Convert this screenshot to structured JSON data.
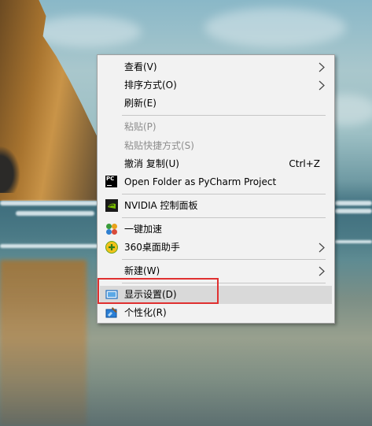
{
  "context_menu": {
    "items": [
      {
        "label": "查看(V)"
      },
      {
        "label": "排序方式(O)"
      },
      {
        "label": "刷新(E)"
      },
      {
        "label": "粘贴(P)"
      },
      {
        "label": "粘贴快捷方式(S)"
      },
      {
        "label": "撤消 复制(U)",
        "shortcut": "Ctrl+Z"
      },
      {
        "label": "Open Folder as PyCharm Project",
        "icon_text": "PC"
      },
      {
        "label": "NVIDIA 控制面板"
      },
      {
        "label": "一键加速"
      },
      {
        "label": "360桌面助手"
      },
      {
        "label": "新建(W)"
      },
      {
        "label": "显示设置(D)"
      },
      {
        "label": "个性化(R)"
      }
    ]
  },
  "colors": {
    "menu_background": "#f2f2f2",
    "highlight": "#d9d9d9",
    "disabled_text": "#8d8d8d",
    "focus_box": "#e03030"
  },
  "icons": {
    "pycharm": "pycharm-icon",
    "nvidia": "nvidia-icon",
    "speedup": "speedup-icon",
    "assistant360": "360-assistant-icon",
    "display": "display-settings-icon",
    "personalize": "personalize-icon"
  }
}
